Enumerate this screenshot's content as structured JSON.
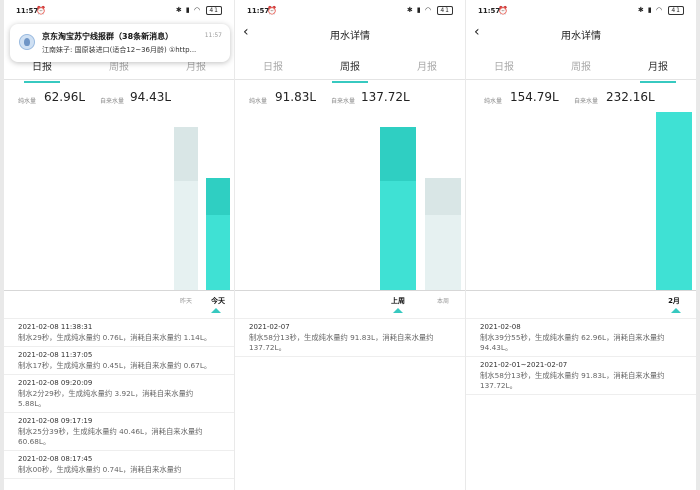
{
  "status": {
    "time": "11:57",
    "battery": "41"
  },
  "colors": {
    "accent": "#37c9c0",
    "pure": "#3fe1d4",
    "pure_dark": "#2fcfc2",
    "tap": "#e6f1f1",
    "tap_dark": "#d9e6e6"
  },
  "notification": {
    "title": "京东淘宝苏宁线报群（38条新消息）",
    "time": "11:57",
    "message": "江南妹子: 国原装进口(适合12~36月龄) ①http..."
  },
  "screens": [
    {
      "title": "用水详情",
      "tabs": [
        "日报",
        "周报",
        "月报"
      ],
      "active_tab": 0,
      "pure_label": "纯水量",
      "pure_value": "62.96L",
      "tap_label": "自来水量",
      "tap_value": "94.43L",
      "chart_data": {
        "type": "bar",
        "categories": [
          "昨天",
          "今天"
        ],
        "series": [
          {
            "values": [
              91.83,
              62.96
            ]
          },
          {
            "values": [
              137.72,
              94.43
            ]
          }
        ],
        "selected": 1
      },
      "records": [
        {
          "date": "2021-02-08 11:38:31",
          "text": "制水29秒，生成纯水量约 0.76L，消耗自来水量约 1.14L。"
        },
        {
          "date": "2021-02-08 11:37:05",
          "text": "制水17秒，生成纯水量约 0.45L，消耗自来水量约 0.67L。"
        },
        {
          "date": "2021-02-08 09:20:09",
          "text": "制水2分29秒，生成纯水量约 3.92L，消耗自来水量约 5.88L。"
        },
        {
          "date": "2021-02-08 09:17:19",
          "text": "制水25分39秒，生成纯水量约 40.46L，消耗自来水量约 60.68L。"
        },
        {
          "date": "2021-02-08 08:17:45",
          "text": "制水00秒，生成纯水量约 0.74L，消耗自来水量约"
        }
      ]
    },
    {
      "title": "用水详情",
      "tabs": [
        "日报",
        "周报",
        "月报"
      ],
      "active_tab": 1,
      "pure_label": "纯水量",
      "pure_value": "91.83L",
      "tap_label": "自来水量",
      "tap_value": "137.72L",
      "chart_data": {
        "type": "bar",
        "categories": [
          "上周",
          "本周"
        ],
        "series": [
          {
            "values": [
              91.83,
              62.96
            ]
          },
          {
            "values": [
              137.72,
              94.43
            ]
          }
        ],
        "selected": 0
      },
      "records": [
        {
          "date": "2021-02-07",
          "text": "制水58分13秒，生成纯水量约 91.83L，消耗自来水量约 137.72L。"
        }
      ]
    },
    {
      "title": "用水详情",
      "tabs": [
        "日报",
        "周报",
        "月报"
      ],
      "active_tab": 2,
      "pure_label": "纯水量",
      "pure_value": "154.79L",
      "tap_label": "自来水量",
      "tap_value": "232.16L",
      "chart_data": {
        "type": "bar",
        "categories": [
          "2月"
        ],
        "series": [
          {
            "values": [
              154.79
            ]
          },
          {
            "values": [
              232.16
            ]
          }
        ],
        "selected": 0
      },
      "records": [
        {
          "date": "2021-02-08",
          "text": "制水39分55秒，生成纯水量约 62.96L，消耗自来水量约 94.43L。"
        },
        {
          "date": "2021-02-01~2021-02-07",
          "text": "制水58分13秒，生成纯水量约 91.83L，消耗自来水量约 137.72L。"
        }
      ]
    }
  ]
}
